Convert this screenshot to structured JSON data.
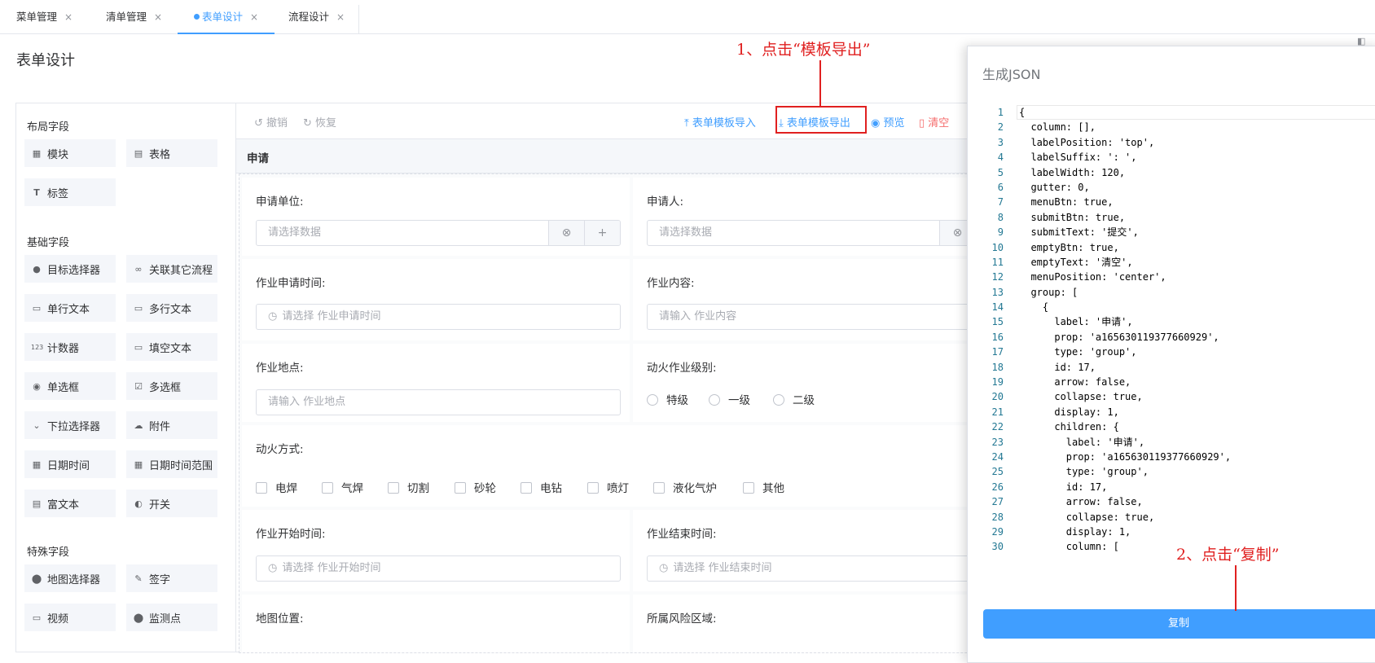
{
  "tabs": [
    {
      "label": "菜单管理",
      "close": "×"
    },
    {
      "label": "清单管理",
      "close": "×"
    },
    {
      "label": "表单设计",
      "close": "×"
    },
    {
      "label": "流程设计",
      "close": "×"
    }
  ],
  "page_title": "表单设计",
  "palette": {
    "layout_title": "布局字段",
    "layout_items": [
      "模块",
      "表格",
      "标签"
    ],
    "basic_title": "基础字段",
    "basic_items": [
      "目标选择器",
      "关联其它流程",
      "单行文本",
      "多行文本",
      "计数器",
      "填空文本",
      "单选框",
      "多选框",
      "下拉选择器",
      "附件",
      "日期时间",
      "日期时间范围",
      "富文本",
      "开关"
    ],
    "special_title": "特殊字段",
    "special_items": [
      "地图选择器",
      "签字",
      "视频",
      "监测点"
    ]
  },
  "toolbar": {
    "undo": "撤销",
    "redo": "恢复",
    "import": "表单模板导入",
    "export": "表单模板导出",
    "preview": "预览",
    "clear": "清空"
  },
  "form": {
    "section": "申请",
    "unit_label": "申请单位:",
    "unit_placeholder": "请选择数据",
    "applicant_label": "申请人:",
    "applicant_placeholder": "请选择数据",
    "apply_time_label": "作业申请时间:",
    "apply_time_placeholder": "请选择 作业申请时间",
    "content_label": "作业内容:",
    "content_placeholder": "请输入 作业内容",
    "place_label": "作业地点:",
    "place_placeholder": "请输入 作业地点",
    "level_label": "动火作业级别:",
    "level_options": [
      "特级",
      "一级",
      "二级"
    ],
    "method_label": "动火方式:",
    "method_options": [
      "电焊",
      "气焊",
      "切割",
      "砂轮",
      "电钻",
      "喷灯",
      "液化气炉",
      "其他"
    ],
    "start_label": "作业开始时间:",
    "start_placeholder": "请选择 作业开始时间",
    "end_label": "作业结束时间:",
    "end_placeholder": "请选择 作业结束时间",
    "map_label": "地图位置:",
    "risk_label": "所属风险区域:"
  },
  "panel": {
    "title": "生成JSON",
    "copy": "复制",
    "lines": [
      "{",
      "  column: [],",
      "  labelPosition: 'top',",
      "  labelSuffix: ': ',",
      "  labelWidth: 120,",
      "  gutter: 0,",
      "  menuBtn: true,",
      "  submitBtn: true,",
      "  submitText: '提交',",
      "  emptyBtn: true,",
      "  emptyText: '清空',",
      "  menuPosition: 'center',",
      "  group: [",
      "    {",
      "      label: '申请',",
      "      prop: 'a165630119377660929',",
      "      type: 'group',",
      "      id: 17,",
      "      arrow: false,",
      "      collapse: true,",
      "      display: 1,",
      "      children: {",
      "        label: '申请',",
      "        prop: 'a165630119377660929',",
      "        type: 'group',",
      "        id: 17,",
      "        arrow: false,",
      "        collapse: true,",
      "        display: 1,",
      "        column: ["
    ]
  },
  "annotations": {
    "step1": "1、点击“模板导出”",
    "step2": "2、点击“复制”"
  }
}
